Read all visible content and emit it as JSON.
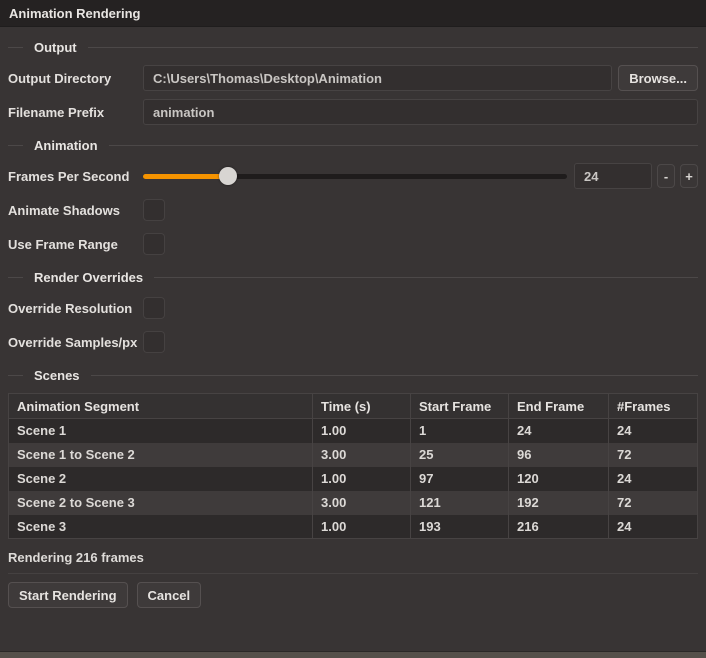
{
  "title_bar": {
    "title": "Animation Rendering"
  },
  "output": {
    "section_label": "Output",
    "output_directory": {
      "label": "Output Directory",
      "value": "C:\\Users\\Thomas\\Desktop\\Animation"
    },
    "browse_button": "Browse...",
    "filename_prefix": {
      "label": "Filename Prefix",
      "value": "animation"
    }
  },
  "animation": {
    "section_label": "Animation",
    "fps": {
      "label": "Frames Per Second",
      "value": "24",
      "slider_percent": 20,
      "decrement_label": "-",
      "increment_label": "+"
    },
    "animate_shadows": {
      "label": "Animate Shadows",
      "checked": false
    },
    "use_frame_range": {
      "label": "Use Frame Range",
      "checked": false
    }
  },
  "render_overrides": {
    "section_label": "Render Overrides",
    "override_resolution": {
      "label": "Override Resolution",
      "checked": false
    },
    "override_samples": {
      "label": "Override Samples/px",
      "checked": false
    }
  },
  "scenes": {
    "section_label": "Scenes",
    "table": {
      "columns": [
        "Animation Segment",
        "Time (s)",
        "Start Frame",
        "End Frame",
        "#Frames"
      ],
      "rows": [
        [
          "Scene 1",
          "1.00",
          "1",
          "24",
          "24"
        ],
        [
          "Scene 1 to Scene 2",
          "3.00",
          "25",
          "96",
          "72"
        ],
        [
          "Scene 2",
          "1.00",
          "97",
          "120",
          "24"
        ],
        [
          "Scene 2 to Scene 3",
          "3.00",
          "121",
          "192",
          "72"
        ],
        [
          "Scene 3",
          "1.00",
          "193",
          "216",
          "24"
        ]
      ]
    }
  },
  "footer": {
    "status": "Rendering 216 frames",
    "start_button": "Start Rendering",
    "cancel_button": "Cancel"
  },
  "colors": {
    "accent_orange": "#f59300",
    "dialog_background": "#383434",
    "titlebar_background": "#252222",
    "row_alt_background": "#3f3b3b"
  }
}
